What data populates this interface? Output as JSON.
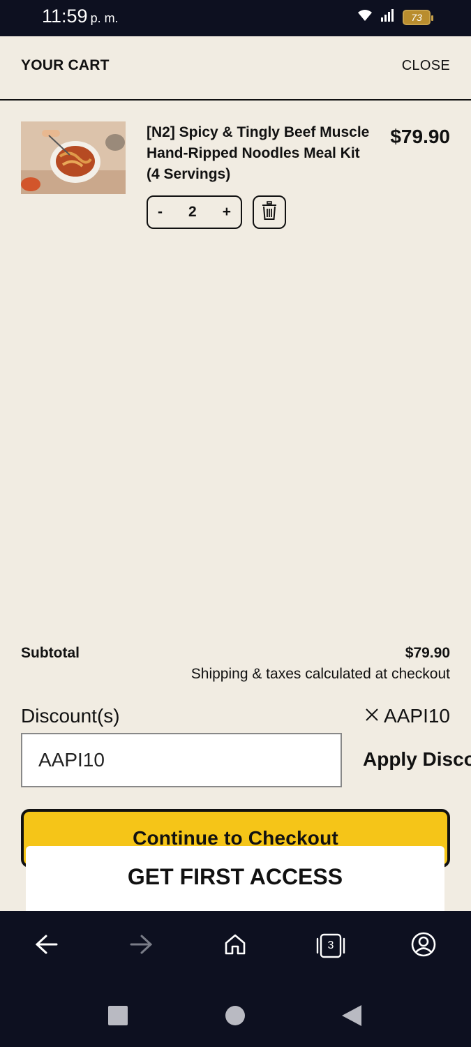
{
  "status_bar": {
    "time": "11:59",
    "ampm": "p. m.",
    "battery": "73"
  },
  "cart": {
    "title": "YOUR CART",
    "close_label": "CLOSE",
    "item": {
      "name": "[N2] Spicy & Tingly Beef Muscle Hand-Ripped Noodles Meal Kit (4 Servings)",
      "price": "$79.90",
      "quantity": "2",
      "decrement": "-",
      "increment": "+"
    },
    "subtotal_label": "Subtotal",
    "subtotal_value": "$79.90",
    "shipping_note": "Shipping & taxes calculated at checkout",
    "discount_label": "Discount(s)",
    "applied_code": "AAPI10",
    "discount_input_value": "AAPI10",
    "apply_label": "Apply Discount",
    "checkout_label": "Continue to Checkout"
  },
  "banner": {
    "text": "GET FIRST ACCESS"
  },
  "browser_nav": {
    "tab_count": "3"
  },
  "colors": {
    "accent": "#f5c518",
    "background": "#f1ece2",
    "dark": "#0d1020"
  }
}
